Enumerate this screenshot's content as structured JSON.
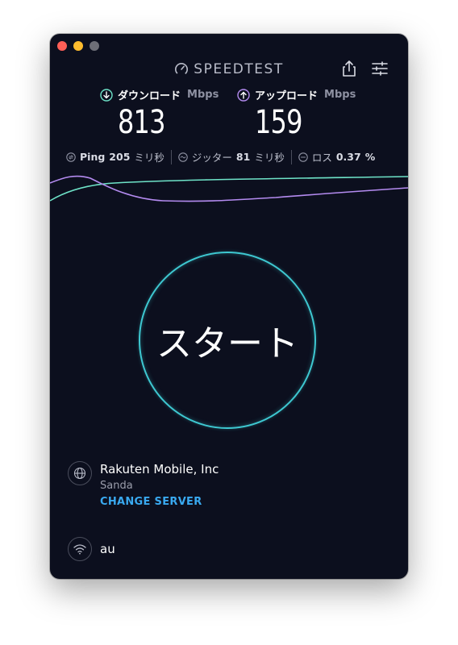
{
  "brand": {
    "title": "SPEEDTEST"
  },
  "metrics": {
    "download": {
      "label": "ダウンロード",
      "unit": "Mbps",
      "value": "813"
    },
    "upload": {
      "label": "アップロード",
      "unit": "Mbps",
      "value": "159"
    }
  },
  "stats": {
    "ping": {
      "label": "Ping",
      "value": "205",
      "unit": "ミリ秒"
    },
    "jitter": {
      "label": "ジッター",
      "value": "81",
      "unit": "ミリ秒"
    },
    "loss": {
      "label": "ロス",
      "value": "0.37",
      "unit": "%"
    }
  },
  "start_button": {
    "label": "スタート"
  },
  "server": {
    "name": "Rakuten Mobile, Inc",
    "location": "Sanda",
    "change_label": "CHANGE SERVER"
  },
  "network": {
    "name": "au"
  },
  "icons": {
    "gauge": "gauge-icon",
    "share": "share-icon",
    "settings": "sliders-icon",
    "download": "arrow-down-circle-icon",
    "upload": "arrow-up-circle-icon",
    "ping": "ping-icon",
    "jitter": "jitter-icon",
    "loss": "loss-icon",
    "globe": "globe-icon",
    "wifi": "wifi-icon"
  },
  "colors": {
    "background": "#0c0f1e",
    "download_accent": "#6ee3c8",
    "upload_accent": "#b48bf0",
    "start_ring": "#3ec8d1",
    "link": "#39a9f0"
  }
}
